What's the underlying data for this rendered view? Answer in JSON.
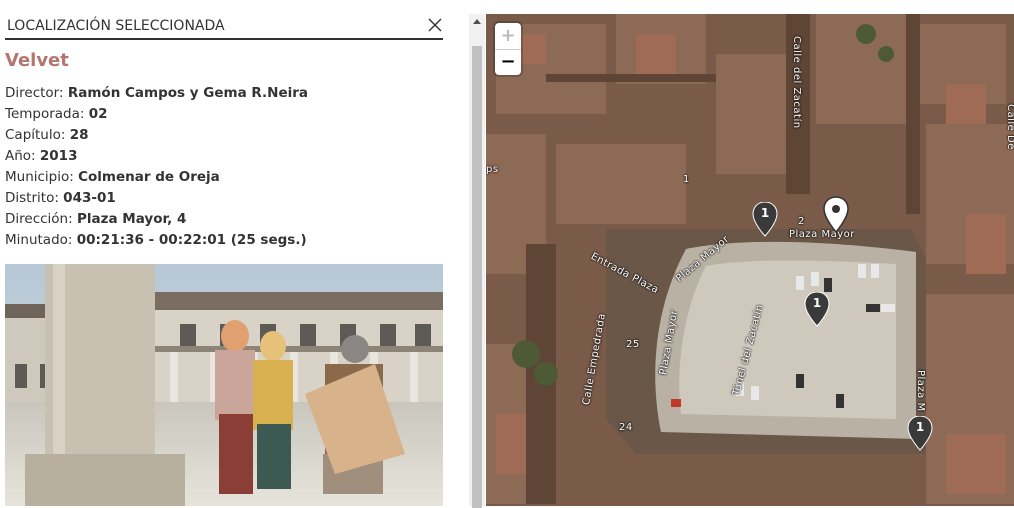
{
  "panel": {
    "title": "LOCALIZACIÓN SELECCIONADA",
    "series_title": "Velvet",
    "details": [
      {
        "label": "Director: ",
        "value": "Ramón Campos y Gema R.Neira"
      },
      {
        "label": "Temporada: ",
        "value": "02"
      },
      {
        "label": "Capítulo: ",
        "value": "28"
      },
      {
        "label": "Año: ",
        "value": "2013"
      },
      {
        "label": "Municipio: ",
        "value": "Colmenar de Oreja"
      },
      {
        "label": "Distrito: ",
        "value": "043-01"
      },
      {
        "label": "Dirección: ",
        "value": "Plaza Mayor, 4"
      },
      {
        "label": "Minutado: ",
        "value": "00:21:36 - 00:22:01 (25 segs.)"
      }
    ]
  },
  "map": {
    "zoom_in": "+",
    "zoom_out": "−",
    "street_labels": {
      "plaza_mayor": "Plaza Mayor",
      "entrada_plaza": "Entrada Plaza",
      "plaza_mayor_diag": "Plaza Mayor",
      "plaza_mayor_west": "Plaza Mayor",
      "calle_empedrada": "Calle Empedrada",
      "tunel_zacatin": "Túnel del Zacatín",
      "calle_zacatin": "Calle del Zacatín",
      "plaza_m": "Plaza M",
      "calle_right": "Calle De",
      "ps": "ps",
      "num_25": "25",
      "num_24": "24",
      "num_1": "1",
      "num_2": "2"
    },
    "markers": [
      {
        "count": "1"
      },
      {
        "count": "1"
      },
      {
        "count": "1"
      }
    ]
  },
  "colors": {
    "accent": "#b5756f",
    "text": "#333333",
    "marker_dark": "#3a3a3a",
    "marker_selected": "#ffffff"
  }
}
